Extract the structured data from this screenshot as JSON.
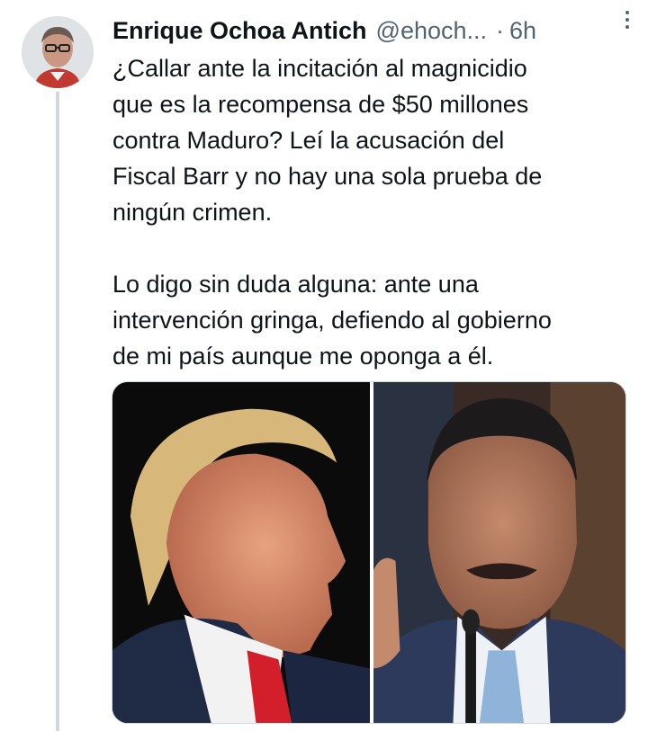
{
  "tweet": {
    "author": {
      "display_name": "Enrique Ochoa Antich",
      "handle": "@ehoch..."
    },
    "separator": "·",
    "time": "6h",
    "paragraphs": [
      "¿Callar ante la incitación al magnicidio\nque es la recompensa de $50 millones\ncontra Maduro? Leí la acusación del\nFiscal Barr y no hay una sola prueba de\nningún crimen.",
      "Lo digo sin duda alguna: ante una\nintervención gringa, defiendo al gobierno\nde mi país aunque me oponga a él."
    ],
    "media": [
      {
        "icon": "photo-profile-man-blond"
      },
      {
        "icon": "photo-man-mustache-microphone"
      }
    ]
  },
  "colors": {
    "text": "#0f1419",
    "muted": "#536471",
    "thread_line": "#cfd9de"
  }
}
